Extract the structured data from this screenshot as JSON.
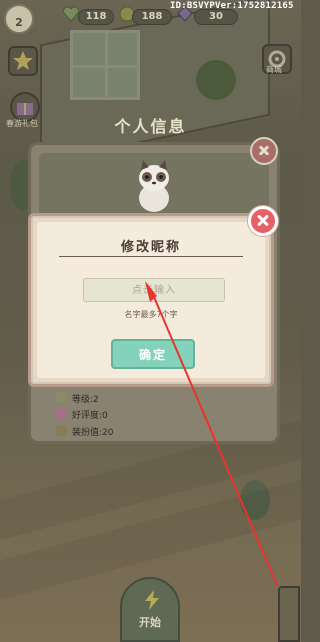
{
  "hud": {
    "level": "2",
    "currency_1": "118",
    "currency_2": "188",
    "currency_3": "30",
    "build_id": "ID:BSVYPVer:1752812165"
  },
  "side_labels": {
    "gift": "春游礼包",
    "shop": "商城"
  },
  "info_panel": {
    "title": "个人信息",
    "stats": [
      {
        "label": "等级:2"
      },
      {
        "label": "好评度:0"
      },
      {
        "label": "装扮值:20"
      }
    ]
  },
  "rename_dialog": {
    "title": "修改昵称",
    "input_placeholder": "点击输入",
    "input_value": "",
    "hint": "名字最多7个字",
    "confirm_label": "确定"
  },
  "bottom": {
    "start_label": "开始"
  },
  "colors": {
    "confirm": "#83d2b9",
    "close": "#e56166",
    "annotation_arrow": "#e8342c"
  }
}
